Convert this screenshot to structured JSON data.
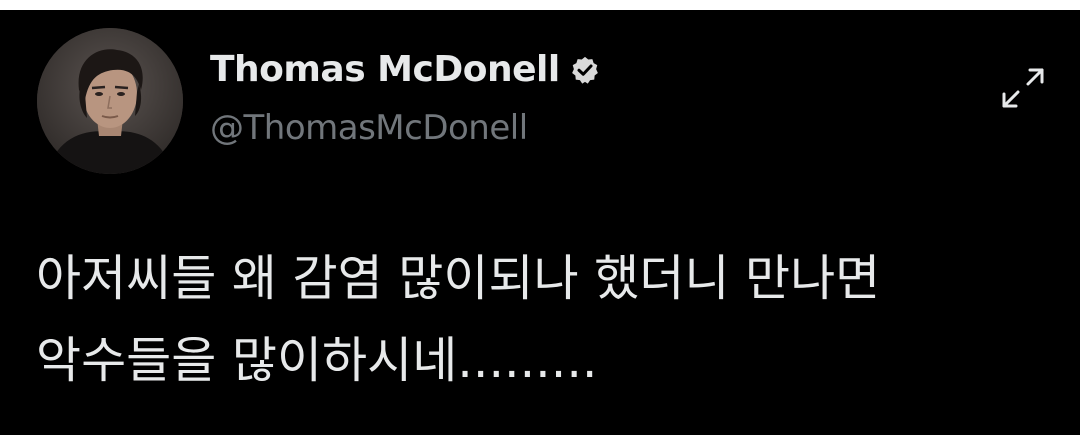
{
  "tweet": {
    "author": {
      "display_name": "Thomas McDonell",
      "handle": "@ThomasMcDonell",
      "verified": true,
      "avatar_icon": "profile-photo"
    },
    "text_lines": [
      "아저씨들 왜 감염 많이되나 했더니 만나면",
      "악수들을 많이하시네........."
    ],
    "expand_icon": "expand-arrows-icon"
  },
  "colors": {
    "background": "#000000",
    "text_primary": "#e7e9ea",
    "text_secondary": "#71767b",
    "verified_badge": "#d9d9d9"
  }
}
